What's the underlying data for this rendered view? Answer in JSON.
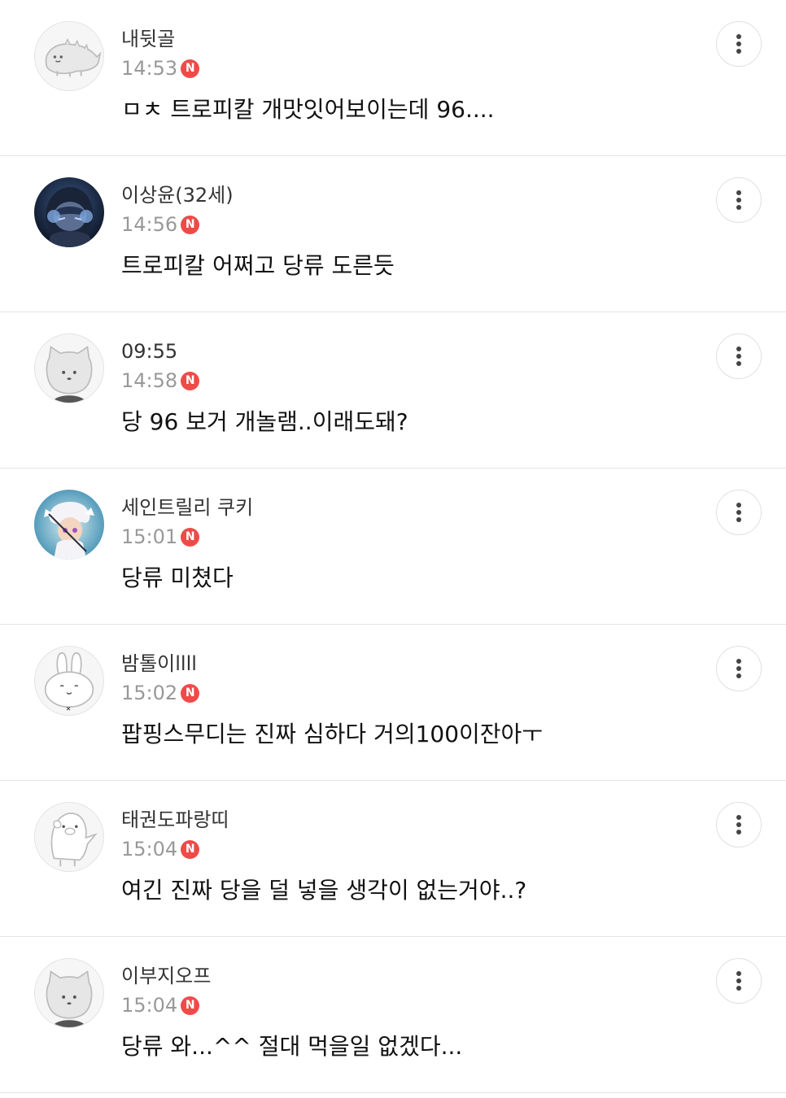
{
  "comments": [
    {
      "nickname": "내뒷골",
      "time": "14:53",
      "new_badge": "N",
      "text": "ㅁㅊ 트로피칼 개맛잇어보이는데 96....",
      "avatar": "default-dino-avatar"
    },
    {
      "nickname": "이상윤(32세)",
      "time": "14:56",
      "new_badge": "N",
      "text": "트로피칼 어쩌고 당류 도른듯",
      "avatar": "anime-headset-avatar"
    },
    {
      "nickname": "09:55",
      "time": "14:58",
      "new_badge": "N",
      "text": "당 96 보거 개놀램..이래도돼?",
      "avatar": "default-cat-avatar"
    },
    {
      "nickname": "세인트릴리 쿠키",
      "time": "15:01",
      "new_badge": "N",
      "text": "당류 미쳤다",
      "avatar": "cookie-character-avatar"
    },
    {
      "nickname": "밤톨이llll",
      "time": "15:02",
      "new_badge": "N",
      "text": "팝핑스무디는 진짜 심하다 거의100이잔아ㅜ",
      "avatar": "default-rabbit-avatar"
    },
    {
      "nickname": "태권도파랑띠",
      "time": "15:04",
      "new_badge": "N",
      "text": "여긴 진짜 당을 덜 넣을 생각이 없는거야..?",
      "avatar": "default-penguin-avatar"
    },
    {
      "nickname": "이부지오프",
      "time": "15:04",
      "new_badge": "N",
      "text": "당류 와...^^ 절대 먹을일 없겠다...",
      "avatar": "default-cat-avatar"
    }
  ],
  "colors": {
    "badge": "#ee4b48",
    "time": "#999999",
    "nickname": "#333333",
    "divider": "#e4e4e4"
  },
  "icons": {
    "more": "more-vertical-icon",
    "new": "new-badge"
  }
}
